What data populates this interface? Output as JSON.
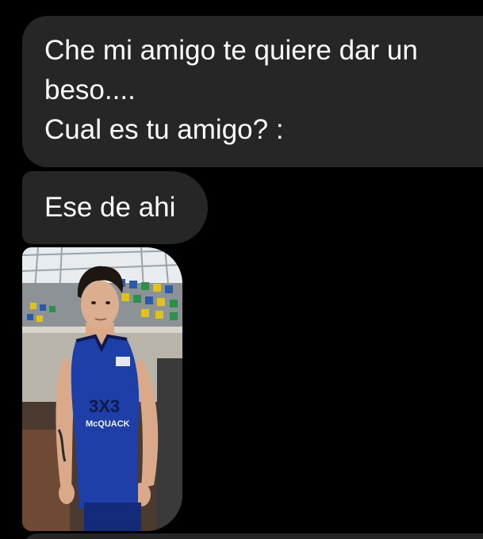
{
  "messages": [
    {
      "lines": [
        "Che mi amigo te quiere dar un",
        "beso....",
        "Cual es tu amigo? :"
      ]
    },
    {
      "text": "Ese de ahi"
    }
  ],
  "photo": {
    "description_icon": "person-photo",
    "jersey_text": "McQUACK",
    "jersey_logo": "3X3"
  },
  "colors": {
    "background": "#000000",
    "bubble": "#262626",
    "text": "#ffffff",
    "jersey": "#1f3fa8"
  }
}
